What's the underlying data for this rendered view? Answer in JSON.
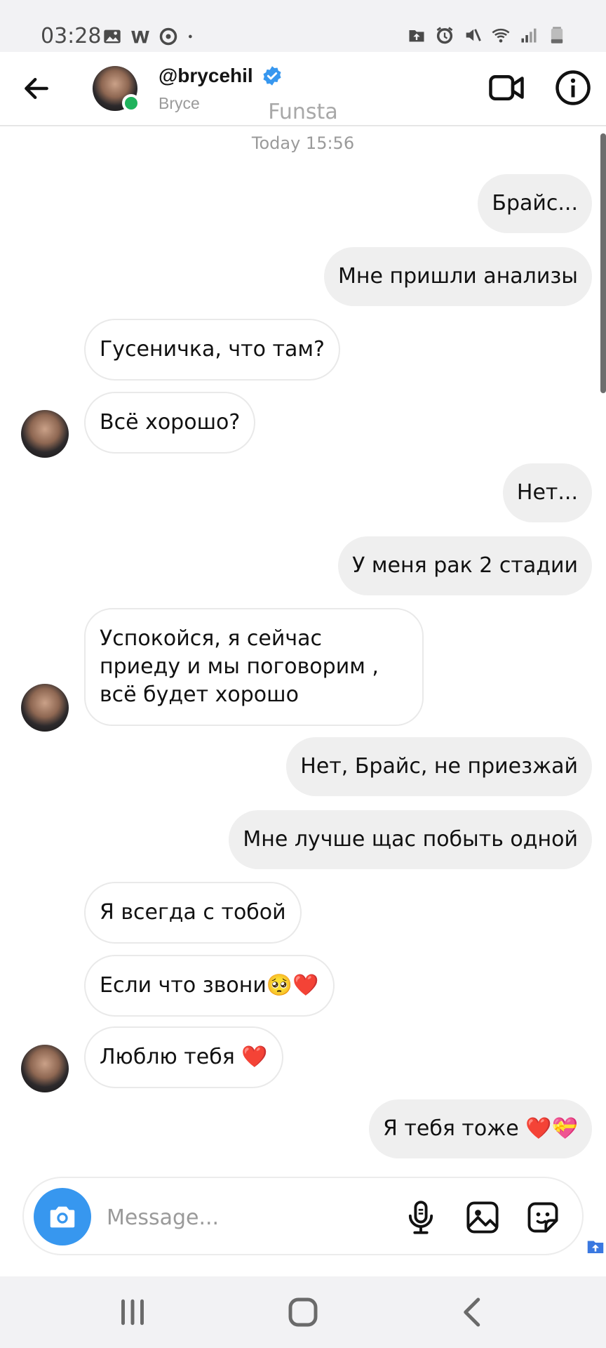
{
  "status_bar": {
    "time": "03:28",
    "left_icons": [
      "image-icon",
      "w-icon",
      "sync-icon",
      "dot-icon"
    ],
    "right_icons": [
      "upload-icon",
      "alarm-icon",
      "mute-icon",
      "wifi-icon",
      "signal-icon",
      "battery-icon"
    ]
  },
  "header": {
    "username": "@brycehil",
    "subname": "Bryce",
    "verified": true
  },
  "funsta": "Funsta",
  "timestamp": "Today 15:56",
  "messages": [
    {
      "dir": "out",
      "text": "Брайс..."
    },
    {
      "dir": "out",
      "text": "Мне пришли анализы"
    },
    {
      "dir": "in",
      "text": "Гусеничка, что там?"
    },
    {
      "dir": "in",
      "text": "Всё хорошо?"
    },
    {
      "dir": "out",
      "text": "Нет..."
    },
    {
      "dir": "out",
      "text": "У меня рак 2 стадии"
    },
    {
      "dir": "in",
      "text": "Успокойся, я сейчас приеду и мы поговорим , всё будет хорошо"
    },
    {
      "dir": "out",
      "text": "Нет, Брайс, не приезжай"
    },
    {
      "dir": "out",
      "text": "Мне лучше щас побыть одной"
    },
    {
      "dir": "in",
      "text": "Я всегда с тобой"
    },
    {
      "dir": "in",
      "text": "Если что звони🥺❤️"
    },
    {
      "dir": "in",
      "text": "Люблю тебя ❤️"
    },
    {
      "dir": "out",
      "text": "Я тебя тоже ❤️💝"
    }
  ],
  "composer": {
    "placeholder": "Message..."
  },
  "colors": {
    "accent_blue": "#3797ef",
    "online_green": "#1fb35c",
    "outgoing_bubble": "#efefef",
    "incoming_border": "#e9e9e9"
  }
}
